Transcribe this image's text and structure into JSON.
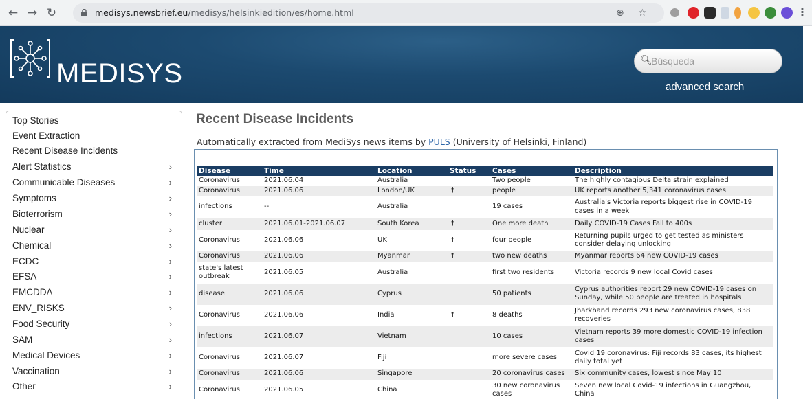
{
  "browser": {
    "url_host": "medisys.newsbrief.eu",
    "url_path": "/medisys/helsinkiedition/es/home.html"
  },
  "header": {
    "logo_text": "MEDISYS",
    "search_placeholder": "Búsqueda",
    "advanced_search": "advanced search"
  },
  "sidebar": {
    "items": [
      {
        "label": "Top Stories",
        "chevron": false
      },
      {
        "label": "Event Extraction",
        "chevron": false
      },
      {
        "label": "Recent Disease Incidents",
        "chevron": false
      },
      {
        "label": "Alert Statistics",
        "chevron": true
      },
      {
        "label": "Communicable Diseases",
        "chevron": true
      },
      {
        "label": "Symptoms",
        "chevron": true
      },
      {
        "label": "Bioterrorism",
        "chevron": true
      },
      {
        "label": "Nuclear",
        "chevron": true
      },
      {
        "label": "Chemical",
        "chevron": true
      },
      {
        "label": "ECDC",
        "chevron": true
      },
      {
        "label": "EFSA",
        "chevron": true
      },
      {
        "label": "EMCDDA",
        "chevron": true
      },
      {
        "label": "ENV_RISKS",
        "chevron": true
      },
      {
        "label": "Food Security",
        "chevron": true
      },
      {
        "label": "SAM",
        "chevron": true
      },
      {
        "label": "Medical Devices",
        "chevron": true
      },
      {
        "label": "Vaccination",
        "chevron": true
      },
      {
        "label": "Other",
        "chevron": true
      }
    ]
  },
  "main": {
    "title": "Recent Disease Incidents",
    "subtitle_prefix": "Automatically extracted from MediSys news items by ",
    "subtitle_link": "PULS",
    "subtitle_suffix": " (University of Helsinki, Finland)",
    "columns": [
      "Disease",
      "Time",
      "Location",
      "Status",
      "Cases",
      "Description"
    ],
    "rows": [
      {
        "disease": "Coronavirus",
        "time": "2021.06.04",
        "location": "Australia",
        "status": "",
        "cases": "Two people",
        "description": "The highly contagious Delta strain explained"
      },
      {
        "disease": "Coronavirus",
        "time": "2021.06.06",
        "location": "London/UK",
        "status": "†",
        "cases": "people",
        "description": "UK reports another 5,341 coronavirus cases"
      },
      {
        "disease": "infections",
        "time": "--",
        "location": "Australia",
        "status": "",
        "cases": "19 cases",
        "description": "Australia's Victoria reports biggest rise in COVID-19 cases in a week"
      },
      {
        "disease": "cluster",
        "time": "2021.06.01-2021.06.07",
        "location": "South Korea",
        "status": "†",
        "cases": "One more death",
        "description": "Daily COVID-19 Cases Fall to 400s"
      },
      {
        "disease": "Coronavirus",
        "time": "2021.06.06",
        "location": "UK",
        "status": "†",
        "cases": "four people",
        "description": "Returning pupils urged to get tested as ministers consider delaying unlocking"
      },
      {
        "disease": "Coronavirus",
        "time": "2021.06.06",
        "location": "Myanmar",
        "status": "†",
        "cases": "two new deaths",
        "description": "Myanmar reports 64 new COVID-19 cases"
      },
      {
        "disease": "state's latest outbreak",
        "time": "2021.06.05",
        "location": "Australia",
        "status": "",
        "cases": "first two residents",
        "description": "Victoria records 9 new local Covid cases"
      },
      {
        "disease": "disease",
        "time": "2021.06.06",
        "location": "Cyprus",
        "status": "",
        "cases": "50 patients",
        "description": "Cyprus authorities report 29 new COVID-19 cases on Sunday, while 50 people are treated in hospitals"
      },
      {
        "disease": "Coronavirus",
        "time": "2021.06.06",
        "location": "India",
        "status": "†",
        "cases": "8 deaths",
        "description": "Jharkhand records 293 new coronavirus cases, 838 recoveries"
      },
      {
        "disease": "infections",
        "time": "2021.06.07",
        "location": "Vietnam",
        "status": "",
        "cases": "10 cases",
        "description": "Vietnam reports 39 more domestic COVID-19 infection cases"
      },
      {
        "disease": "Coronavirus",
        "time": "2021.06.07",
        "location": "Fiji",
        "status": "",
        "cases": "more severe cases",
        "description": "Covid 19 coronavirus: Fiji records 83 cases, its highest daily total yet"
      },
      {
        "disease": "Coronavirus",
        "time": "2021.06.06",
        "location": "Singapore",
        "status": "",
        "cases": "20 coronavirus cases",
        "description": "Six community cases, lowest since May 10"
      },
      {
        "disease": "Coronavirus",
        "time": "2021.06.05",
        "location": "China",
        "status": "",
        "cases": "30 new coronavirus cases",
        "description": "Seven new local Covid-19 infections in Guangzhou, China"
      }
    ]
  },
  "colors": {
    "banner": "#1c4a70",
    "table_header": "#1a3d63",
    "link": "#2d66a8"
  }
}
